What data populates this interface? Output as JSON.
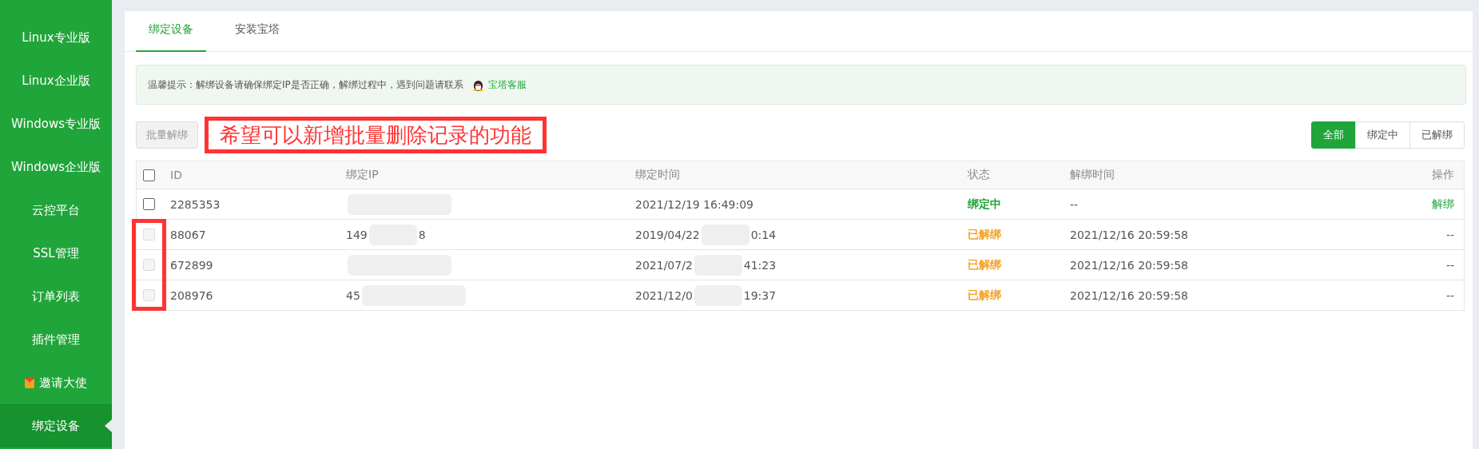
{
  "sidebar": {
    "items": [
      {
        "label": "Linux专业版",
        "selected": false,
        "kind": "plain"
      },
      {
        "label": "Linux企业版",
        "selected": false,
        "kind": "plain"
      },
      {
        "label": "Windows专业版",
        "selected": false,
        "kind": "plain"
      },
      {
        "label": "Windows企业版",
        "selected": false,
        "kind": "plain"
      },
      {
        "label": "云控平台",
        "selected": false,
        "kind": "plain"
      },
      {
        "label": "SSL管理",
        "selected": false,
        "kind": "plain"
      },
      {
        "label": "订单列表",
        "selected": false,
        "kind": "plain"
      },
      {
        "label": "插件管理",
        "selected": false,
        "kind": "plain"
      },
      {
        "label": "邀请大使",
        "selected": false,
        "kind": "gift"
      },
      {
        "label": "绑定设备",
        "selected": true,
        "kind": "plain"
      }
    ]
  },
  "tabs": [
    {
      "label": "绑定设备",
      "selected": true
    },
    {
      "label": "安装宝塔",
      "selected": false
    }
  ],
  "notice": {
    "text": "温馨提示：解绑设备请确保绑定IP是否正确，解绑过程中，遇到问题请联系",
    "link": "宝塔客服"
  },
  "batch_button": {
    "label": "批量解绑",
    "disabled": true
  },
  "annotation": {
    "text": "希望可以新增批量删除记录的功能"
  },
  "filters": [
    {
      "label": "全部",
      "selected": true
    },
    {
      "label": "绑定中",
      "selected": false
    },
    {
      "label": "已解绑",
      "selected": false
    }
  ],
  "table": {
    "columns": [
      "ID",
      "绑定IP",
      "绑定时间",
      "状态",
      "解绑时间",
      "操作"
    ],
    "header_checked": false,
    "rows": [
      {
        "checked": false,
        "disabled": false,
        "marked": false,
        "id": "2285353",
        "bind_time": [
          "2021/12/19 16:49:09"
        ],
        "status": {
          "text": "绑定中",
          "color": "#20a53a"
        },
        "unbind_time": "--",
        "action": {
          "text": "解绑",
          "kind": "link"
        }
      },
      {
        "checked": false,
        "disabled": true,
        "marked": true,
        "id": "88067",
        "ip": [
          "149",
          "8"
        ],
        "bind_time": [
          "2019/04/22",
          "0:14"
        ],
        "status": {
          "text": "已解绑",
          "color": "#f7a023"
        },
        "unbind_time": "2021/12/16 20:59:58",
        "action": {
          "text": "--",
          "kind": "text"
        }
      },
      {
        "checked": false,
        "disabled": true,
        "marked": true,
        "id": "672899",
        "bind_time": [
          "2021/07/2",
          "41:23"
        ],
        "status": {
          "text": "已解绑",
          "color": "#f7a023"
        },
        "unbind_time": "2021/12/16 20:59:58",
        "action": {
          "text": "--",
          "kind": "text"
        }
      },
      {
        "checked": false,
        "disabled": true,
        "marked": true,
        "id": "208976",
        "ip": [
          "45"
        ],
        "bind_time": [
          "2021/12/0",
          "19:37"
        ],
        "status": {
          "text": "已解绑",
          "color": "#f7a023"
        },
        "unbind_time": "2021/12/16 20:59:58",
        "action": {
          "text": "--",
          "kind": "text"
        }
      }
    ]
  }
}
